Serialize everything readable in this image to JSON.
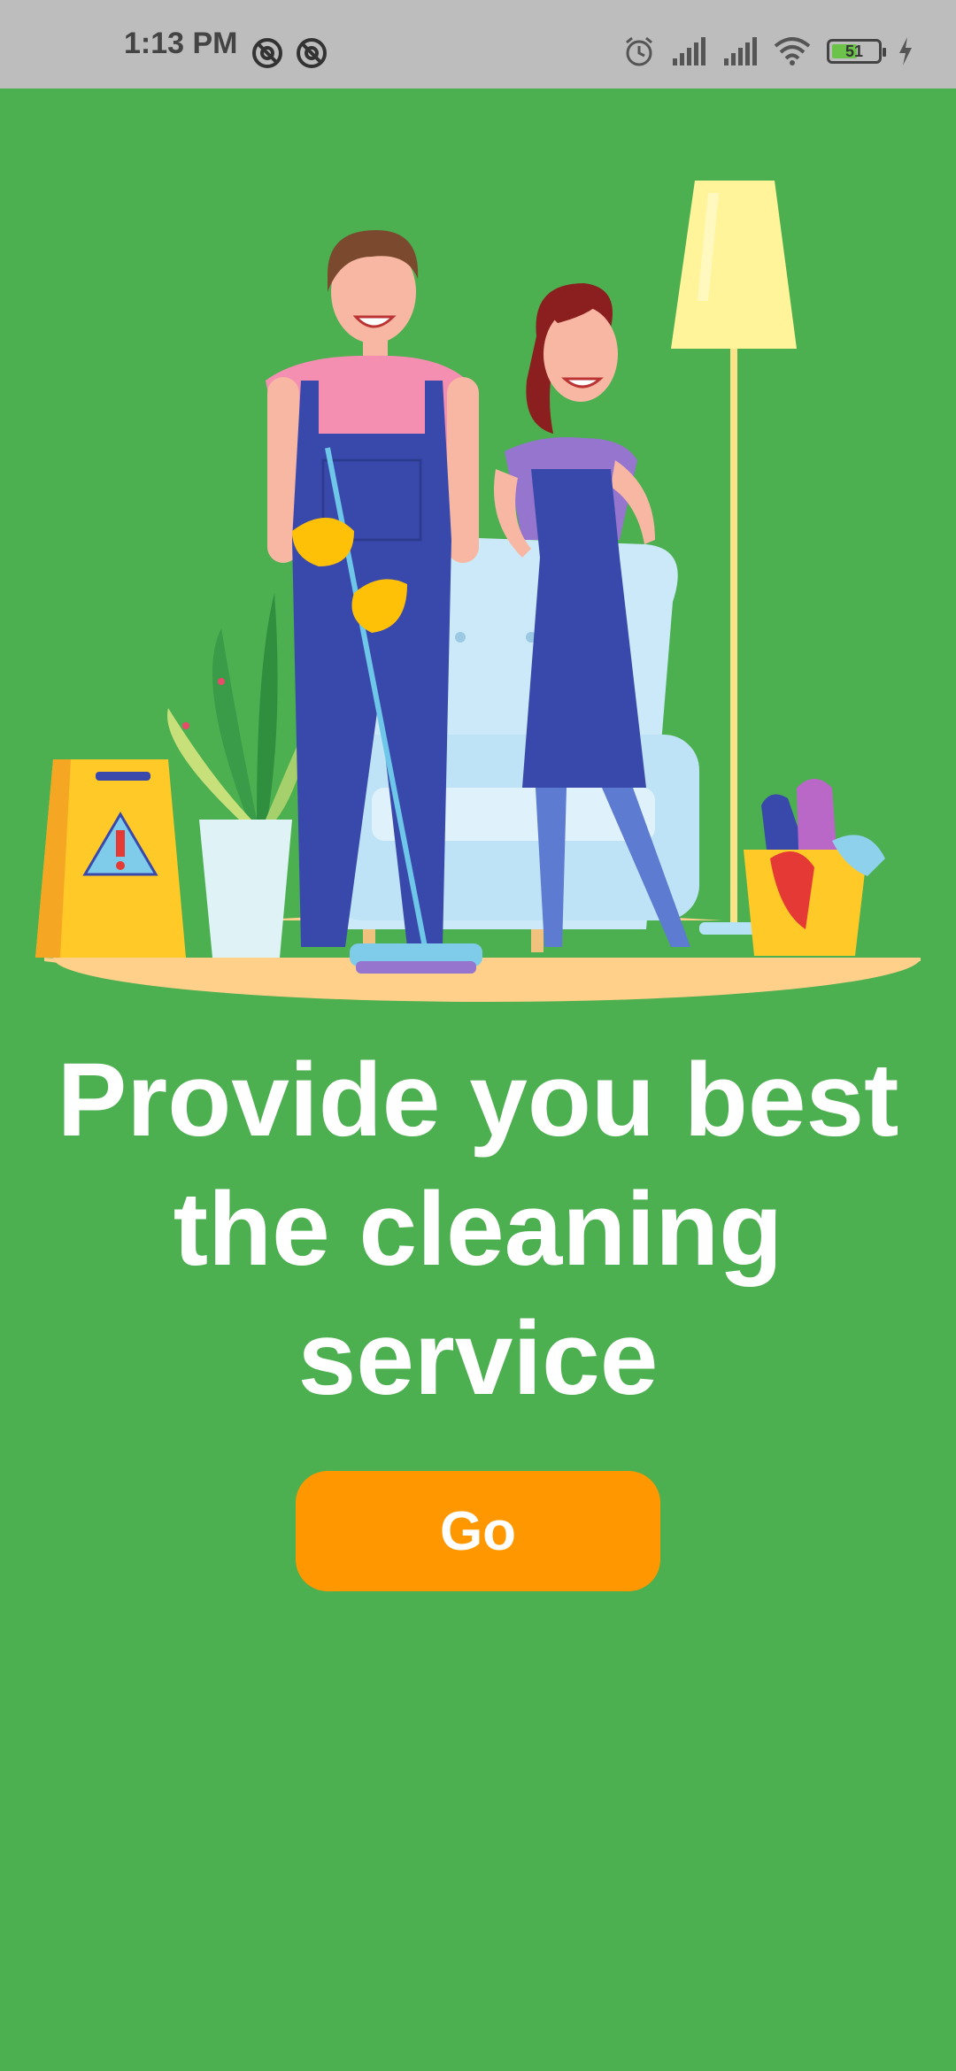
{
  "status_bar": {
    "time": "1:13 PM",
    "battery_level": "51",
    "icons": [
      "sync-icon",
      "sync-icon",
      "alarm-icon",
      "signal-icon",
      "signal-icon",
      "wifi-icon",
      "battery-icon",
      "charging-icon"
    ]
  },
  "onboarding": {
    "headline": "Provide you best the cleaning service",
    "go_button_label": "Go"
  },
  "colors": {
    "background": "#4caf50",
    "button": "#ff9800",
    "status_bar": "#bdbdbd"
  }
}
